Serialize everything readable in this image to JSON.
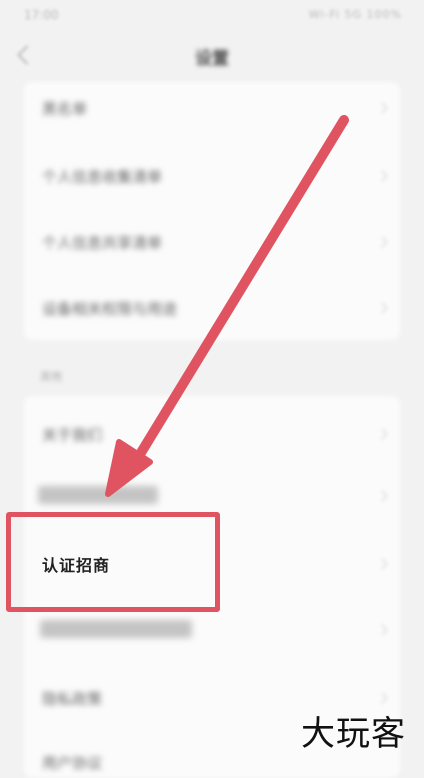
{
  "status_bar": {
    "time": "17:00",
    "indicators": "Wi-Fi 5G 100%"
  },
  "header": {
    "title": "设置"
  },
  "section1": {
    "items": [
      {
        "label": "黑名单"
      },
      {
        "label": "个人信息收集清单"
      },
      {
        "label": "个人信息共享清单"
      },
      {
        "label": "设备相关权限与用途"
      }
    ]
  },
  "section2": {
    "title": "其他",
    "items": [
      {
        "label": "关于我们"
      },
      {
        "label": "认证招商"
      },
      {
        "label": "隐私政策"
      },
      {
        "label": "用户协议"
      }
    ]
  },
  "highlight": {
    "label": "认证招商",
    "color": "#e05461"
  },
  "watermark": {
    "text": "大玩客"
  }
}
